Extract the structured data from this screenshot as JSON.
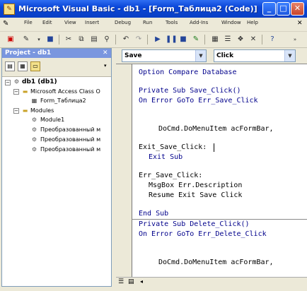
{
  "window": {
    "title": "Microsoft Visual Basic - db1 - [Form_Таблица2 (Code)]",
    "controls": {
      "minimize": "_",
      "maximize": "□",
      "close": "✕"
    }
  },
  "menubar": {
    "items": [
      "File",
      "Edit",
      "View",
      "Insert",
      "Debug",
      "Run",
      "Tools",
      "Add-Ins",
      "Window",
      "Help"
    ],
    "close_glyph": "✕"
  },
  "project": {
    "title": "Project - db1",
    "close_glyph": "✕",
    "tree": {
      "root": "db1 (db1)",
      "objects_folder": "Microsoft Access Class O",
      "form": "Form_Таблица2",
      "modules_folder": "Modules",
      "modules": [
        "Module1",
        "Преобразованный м",
        "Преобразованный м",
        "Преобразованный м"
      ]
    }
  },
  "code": {
    "object_combo": "Save",
    "proc_combo": "Click",
    "lines": [
      "Option Compare Database",
      "Private Sub Save_Click()",
      "On Error GoTo Err_Save_Click",
      "DoCmd.DoMenuItem acFormBar,",
      "Exit_Save_Click:",
      "Exit Sub",
      "Err_Save_Click:",
      "MsgBox Err.Description",
      "Resume Exit Save Click",
      "End Sub",
      "Private Sub Delete_Click()",
      "On Error GoTo Err_Delete_Click",
      "DoCmd.DoMenuItem acFormBar,"
    ]
  },
  "colors": {
    "title_bar": "#0a46d8",
    "keyword": "#00008b",
    "project_title": "#7a96df"
  }
}
